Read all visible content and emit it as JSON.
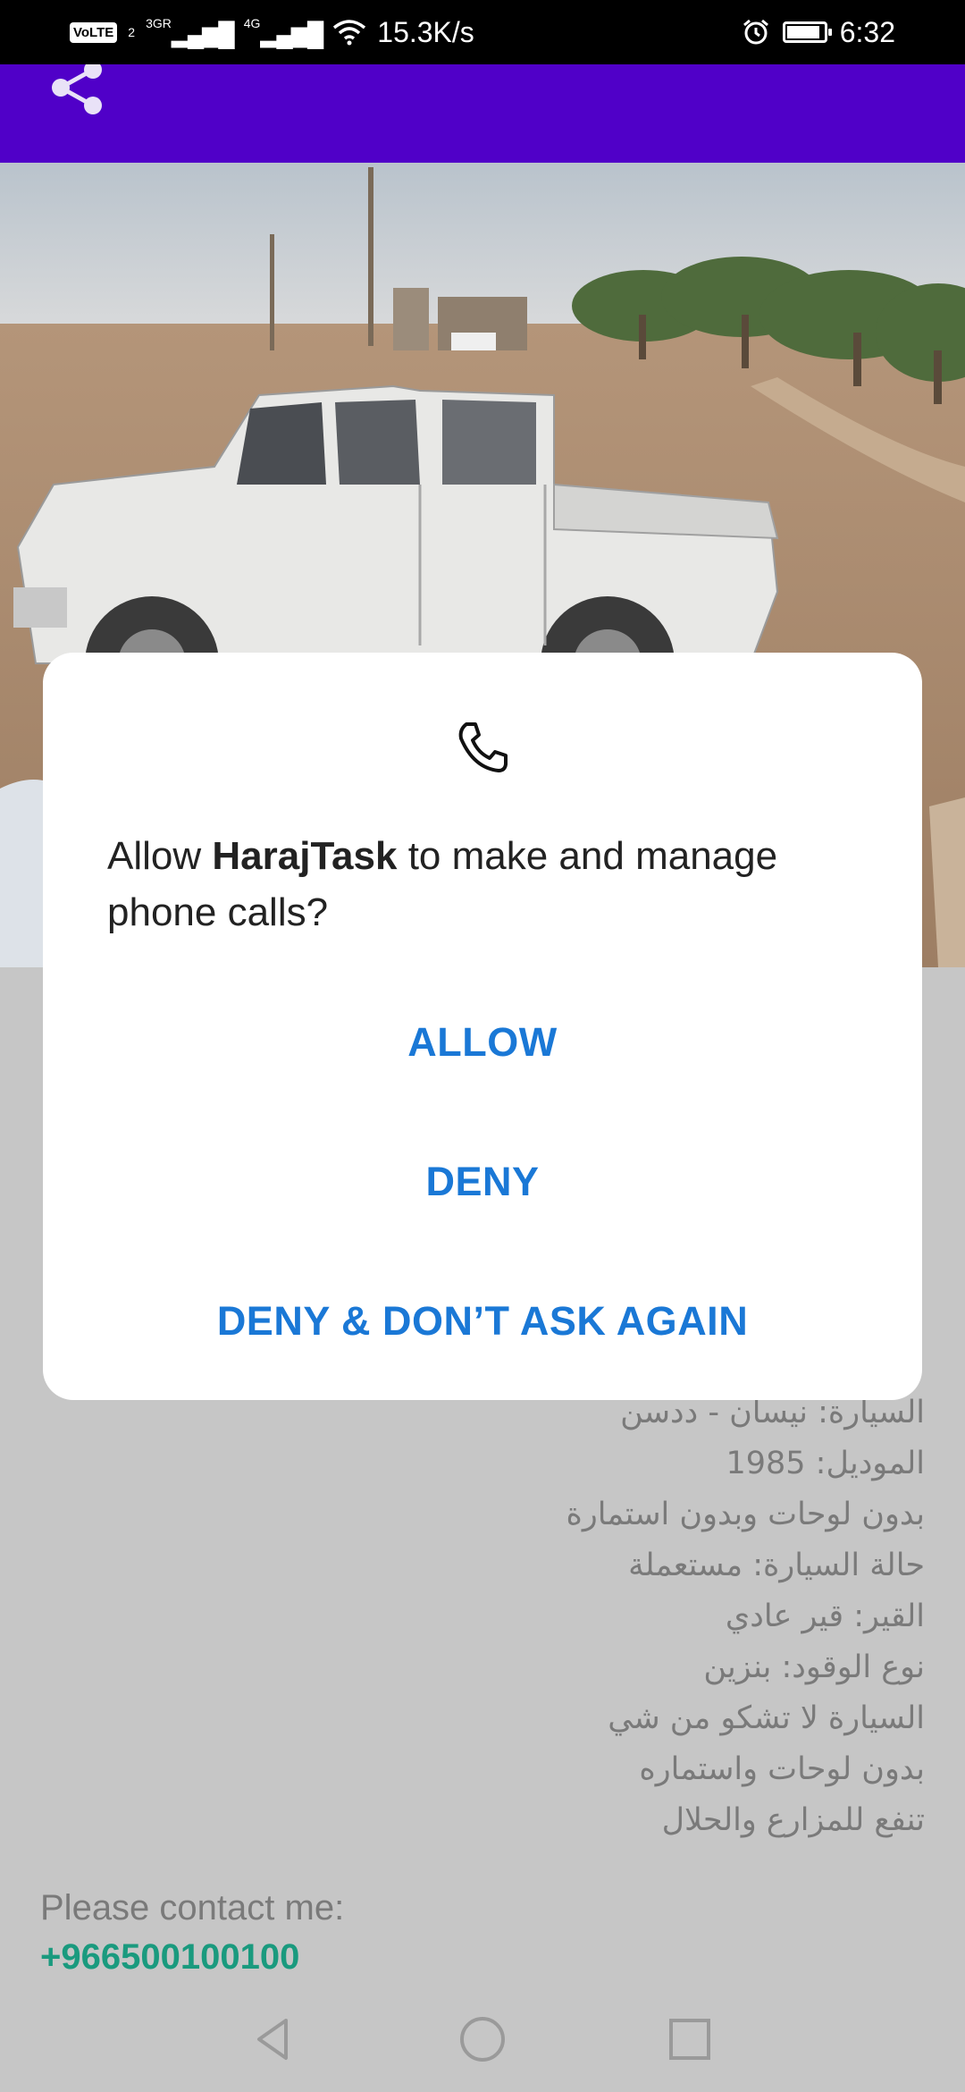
{
  "status_bar": {
    "volte": "VoLTE",
    "sim": "2",
    "net1": "3G",
    "net1_sub": "R",
    "net2": "4G",
    "speed": "15.3K/s",
    "time": "6:32",
    "battery_level": 0.9
  },
  "toolbar": {
    "accent_color": "#5000c8",
    "share_icon": "share-icon"
  },
  "listing": {
    "description_lines": [
      "السيارة: نيسان - ددسن",
      "الموديل: 1985",
      "بدون لوحات وبدون استمارة",
      "حالة السيارة: مستعملة",
      "القير: قير عادي",
      "نوع الوقود: بنزين",
      "السيارة لا تشكو من شي",
      "بدون لوحات واستماره",
      "تنفع للمزارع والحلال"
    ],
    "contact_label": "Please contact me:",
    "contact_phone": "+966500100100"
  },
  "dialog": {
    "icon": "phone-icon",
    "message_prefix": "Allow ",
    "app_name": "HarajTask",
    "message_suffix": " to make and manage phone calls?",
    "allow_label": "ALLOW",
    "deny_label": "DENY",
    "deny_never_label": "DENY & DON’T ASK AGAIN",
    "button_color": "#1a78d6"
  },
  "nav": {
    "back_icon": "back-icon",
    "home_icon": "home-icon",
    "recents_icon": "recents-icon"
  }
}
